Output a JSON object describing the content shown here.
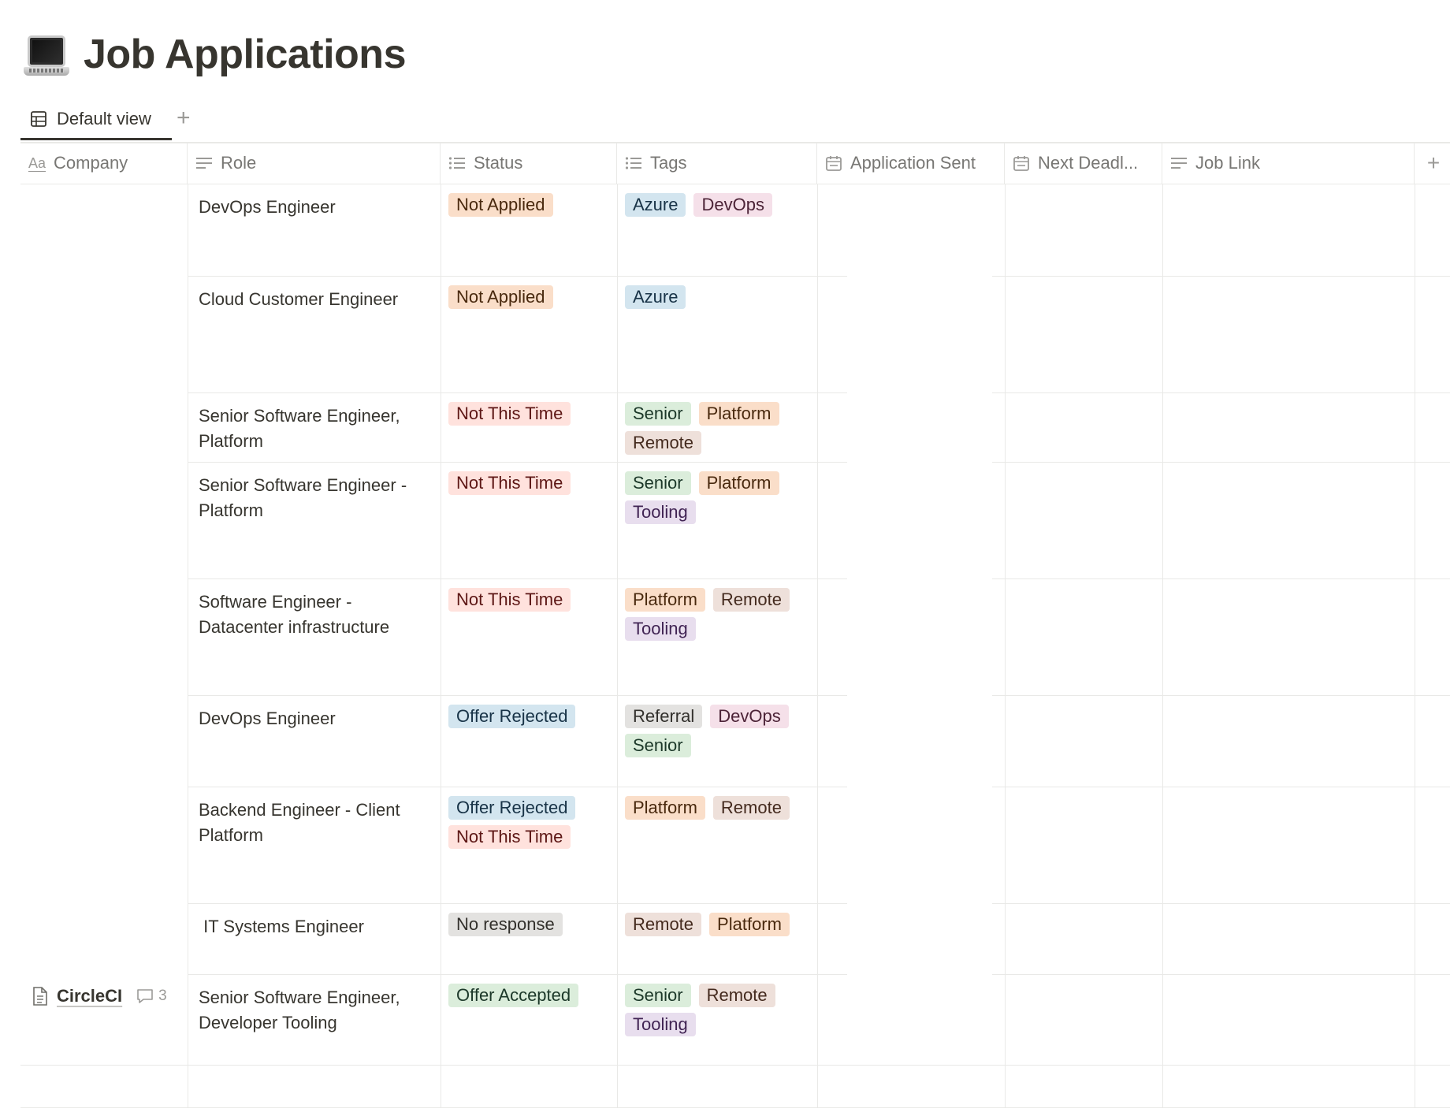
{
  "page": {
    "title": "Job Applications",
    "icon": "laptop-icon"
  },
  "tabs": {
    "active_label": "Default view",
    "add_label": "+"
  },
  "columns": [
    {
      "label": "Company",
      "icon": "title-aa-icon"
    },
    {
      "label": "Role",
      "icon": "text-lines-icon"
    },
    {
      "label": "Status",
      "icon": "multi-select-list-icon"
    },
    {
      "label": "Tags",
      "icon": "multi-select-list-icon"
    },
    {
      "label": "Application Sent",
      "icon": "calendar-icon"
    },
    {
      "label": "Next Deadl...",
      "icon": "calendar-icon"
    },
    {
      "label": "Job Link",
      "icon": "text-lines-icon"
    }
  ],
  "add_column_label": "+",
  "colors": {
    "orange": {
      "bg": "#fadec9",
      "fg": "#49290e"
    },
    "red": {
      "bg": "#ffe2dd",
      "fg": "#5d1715"
    },
    "blue": {
      "bg": "#d3e5ef",
      "fg": "#183347"
    },
    "pink": {
      "bg": "#f5e0e9",
      "fg": "#4c2337"
    },
    "green": {
      "bg": "#dbeddb",
      "fg": "#1c3829"
    },
    "brown": {
      "bg": "#eee0da",
      "fg": "#442a1e"
    },
    "purple": {
      "bg": "#e8deee",
      "fg": "#412454"
    },
    "gray": {
      "bg": "#e3e2e0",
      "fg": "#32302c"
    }
  },
  "rows": [
    {
      "company": "",
      "role": "DevOps Engineer",
      "status": [
        {
          "label": "Not Applied",
          "color": "orange"
        }
      ],
      "tags": [
        {
          "label": "Azure",
          "color": "blue"
        },
        {
          "label": "DevOps",
          "color": "pink"
        }
      ]
    },
    {
      "company": "",
      "role": "Cloud Customer Engineer",
      "status": [
        {
          "label": "Not Applied",
          "color": "orange"
        }
      ],
      "tags": [
        {
          "label": "Azure",
          "color": "blue"
        }
      ]
    },
    {
      "company": "",
      "role": "Senior Software Engineer, Platform",
      "status": [
        {
          "label": "Not This Time",
          "color": "red"
        }
      ],
      "tags": [
        {
          "label": "Senior",
          "color": "green"
        },
        {
          "label": "Platform",
          "color": "orange"
        },
        {
          "label": "Remote",
          "color": "brown"
        }
      ]
    },
    {
      "company": "",
      "role": "Senior Software Engineer - Platform",
      "status": [
        {
          "label": "Not This Time",
          "color": "red"
        }
      ],
      "tags": [
        {
          "label": "Senior",
          "color": "green"
        },
        {
          "label": "Platform",
          "color": "orange"
        },
        {
          "label": "Tooling",
          "color": "purple"
        }
      ]
    },
    {
      "company": "",
      "role": "Software Engineer - Datacenter infrastructure",
      "status": [
        {
          "label": "Not This Time",
          "color": "red"
        }
      ],
      "tags": [
        {
          "label": "Platform",
          "color": "orange"
        },
        {
          "label": "Remote",
          "color": "brown"
        },
        {
          "label": "Tooling",
          "color": "purple"
        }
      ]
    },
    {
      "company": "",
      "role": "DevOps Engineer",
      "status": [
        {
          "label": "Offer Rejected",
          "color": "blue"
        }
      ],
      "tags": [
        {
          "label": "Referral",
          "color": "gray"
        },
        {
          "label": "DevOps",
          "color": "pink"
        },
        {
          "label": "Senior",
          "color": "green"
        }
      ]
    },
    {
      "company": "",
      "role": "Backend Engineer - Client Platform",
      "status": [
        {
          "label": "Offer Rejected",
          "color": "blue"
        },
        {
          "label": "Not This Time",
          "color": "red"
        }
      ],
      "tags": [
        {
          "label": "Platform",
          "color": "orange"
        },
        {
          "label": "Remote",
          "color": "brown"
        }
      ]
    },
    {
      "company": "",
      "role": " IT Systems Engineer",
      "status": [
        {
          "label": "No response",
          "color": "gray"
        }
      ],
      "tags": [
        {
          "label": "Remote",
          "color": "brown"
        },
        {
          "label": "Platform",
          "color": "orange"
        }
      ]
    },
    {
      "company": "CircleCI",
      "comments": "3",
      "role": "Senior Software Engineer, Developer Tooling",
      "status": [
        {
          "label": "Offer Accepted",
          "color": "green"
        }
      ],
      "tags": [
        {
          "label": "Senior",
          "color": "green"
        },
        {
          "label": "Remote",
          "color": "brown"
        },
        {
          "label": "Tooling",
          "color": "purple"
        }
      ]
    }
  ]
}
